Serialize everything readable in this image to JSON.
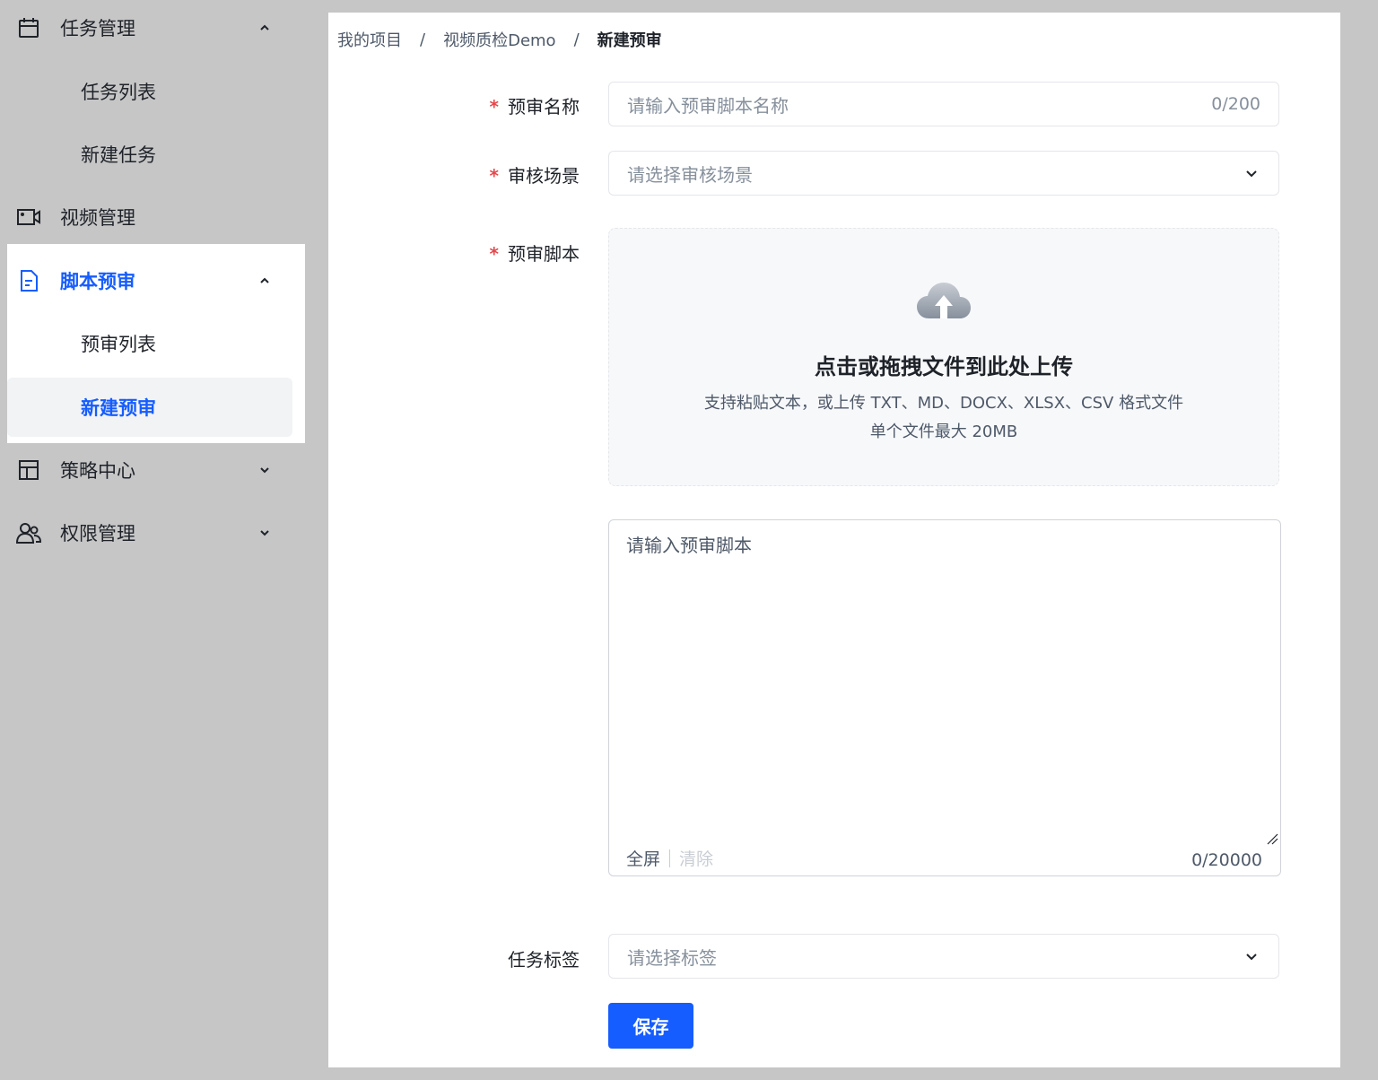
{
  "sidebar": {
    "groups": [
      {
        "label": "任务管理",
        "icon": "calendar-icon",
        "expanded": true,
        "children": [
          "任务列表",
          "新建任务"
        ]
      },
      {
        "label": "视频管理",
        "icon": "video-icon"
      },
      {
        "label": "脚本预审",
        "icon": "document-icon",
        "expanded": true,
        "active": true,
        "children": [
          "预审列表",
          "新建预审"
        ]
      },
      {
        "label": "策略中心",
        "icon": "layout-icon",
        "expanded": false
      },
      {
        "label": "权限管理",
        "icon": "users-icon",
        "expanded": false
      }
    ],
    "selected_child": "新建预审",
    "accent_color": "#165dff"
  },
  "breadcrumb": {
    "items": [
      "我的项目",
      "视频质检Demo",
      "新建预审"
    ],
    "separator": "/"
  },
  "form": {
    "name": {
      "label": "预审名称",
      "placeholder": "请输入预审脚本名称",
      "count": "0/200",
      "required": true
    },
    "scene": {
      "label": "审核场景",
      "placeholder": "请选择审核场景",
      "required": true
    },
    "script": {
      "label": "预审脚本",
      "required": true,
      "upload_title": "点击或拖拽文件到此处上传",
      "upload_hint": "支持粘贴文本，或上传 TXT、MD、DOCX、XLSX、CSV 格式文件",
      "upload_limit": "单个文件最大 20MB",
      "textarea_placeholder": "请输入预审脚本",
      "fullscreen": "全屏",
      "clear": "清除",
      "count": "0/20000"
    },
    "tags": {
      "label": "任务标签",
      "placeholder": "请选择标签"
    },
    "save": "保存"
  }
}
